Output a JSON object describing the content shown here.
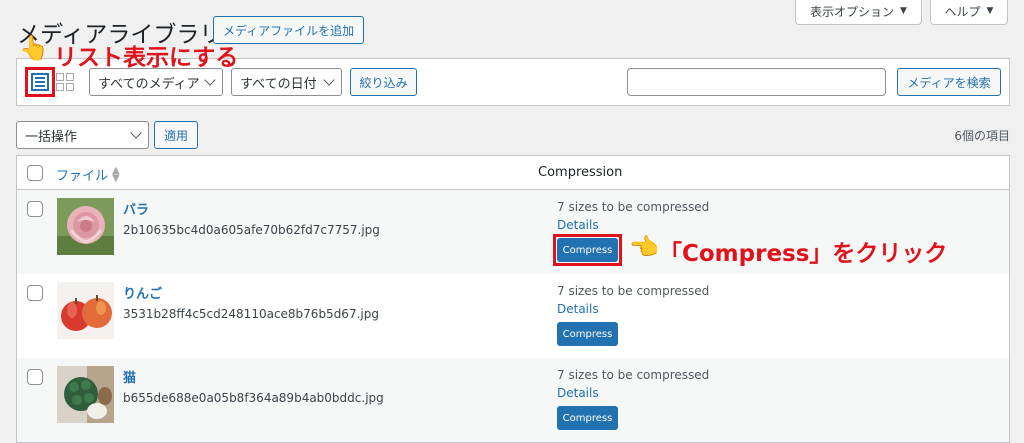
{
  "header": {
    "screen_options_label": "表示オプション",
    "help_label": "ヘルプ",
    "page_title": "メディアライブラリ",
    "add_new_label": "メディアファイルを追加"
  },
  "annotations": {
    "list_view_hint": "リスト表示にする",
    "compress_hint": "「Compress」をクリック"
  },
  "filter": {
    "media_type_value": "すべてのメディア",
    "date_value": "すべての日付",
    "filter_button": "絞り込み",
    "search_placeholder": "",
    "search_button": "メディアを検索"
  },
  "bulk": {
    "action_value": "一括操作",
    "apply_label": "適用",
    "items_count": "6個の項目"
  },
  "table": {
    "col_file": "ファイル",
    "col_compression": "Compression",
    "rows": [
      {
        "title": "バラ",
        "filename": "2b10635bc4d0a605afe70b62fd7c7757.jpg",
        "status": "7 sizes to be compressed",
        "details": "Details",
        "compress": "Compress"
      },
      {
        "title": "りんご",
        "filename": "3531b28ff4c5cd248110ace8b76b5d67.jpg",
        "status": "7 sizes to be compressed",
        "details": "Details",
        "compress": "Compress"
      },
      {
        "title": "猫",
        "filename": "b655de688e0a05b8f364a89b4ab0bddc.jpg",
        "status": "7 sizes to be compressed",
        "details": "Details",
        "compress": "Compress"
      }
    ]
  },
  "colors": {
    "accent": "#2271b1",
    "annotation": "#e0121b"
  }
}
